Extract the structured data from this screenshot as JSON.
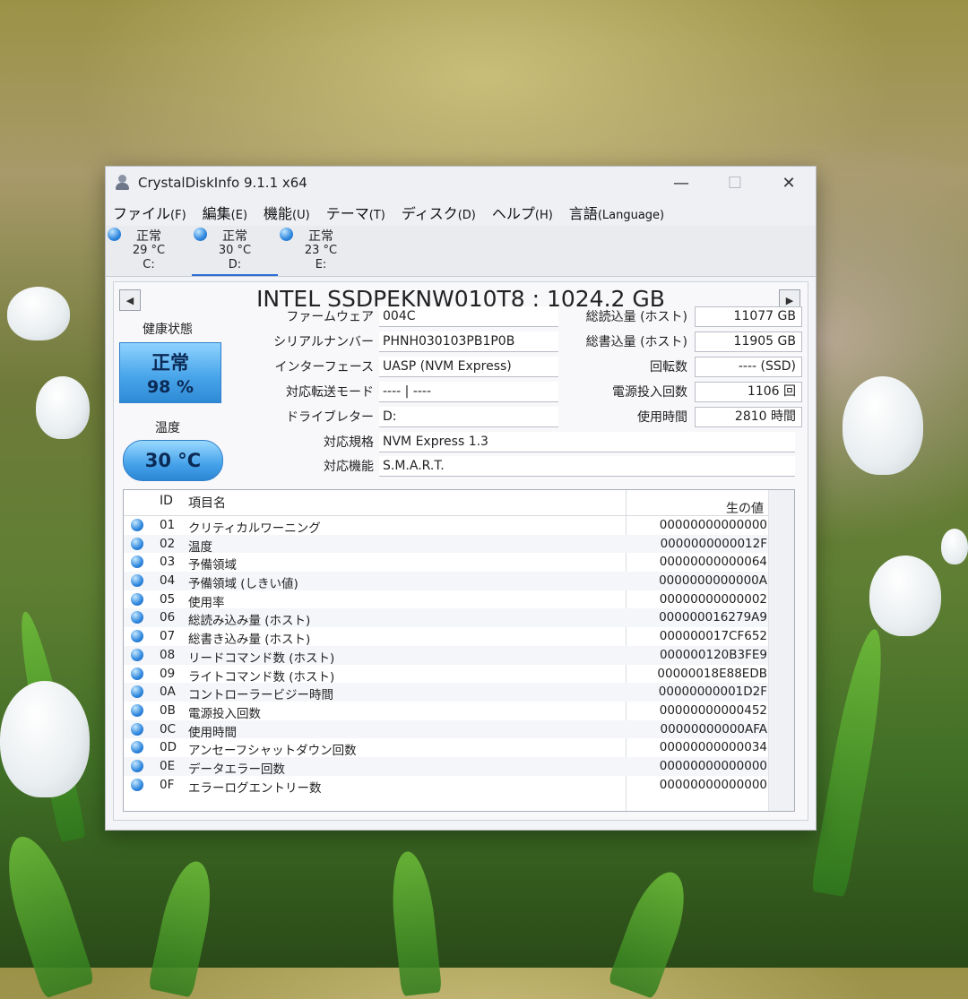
{
  "window": {
    "title": "CrystalDiskInfo 9.1.1 x64"
  },
  "menu": [
    {
      "label": "ファイル",
      "key": "(F)"
    },
    {
      "label": "編集",
      "key": "(E)"
    },
    {
      "label": "機能",
      "key": "(U)"
    },
    {
      "label": "テーマ",
      "key": "(T)"
    },
    {
      "label": "ディスク",
      "key": "(D)"
    },
    {
      "label": "ヘルプ",
      "key": "(H)"
    },
    {
      "label": "言語",
      "key": "(Language)"
    }
  ],
  "drives": [
    {
      "status": "正常",
      "temp": "29 °C",
      "letter": "C:"
    },
    {
      "status": "正常",
      "temp": "30 °C",
      "letter": "D:"
    },
    {
      "status": "正常",
      "temp": "23 °C",
      "letter": "E:"
    }
  ],
  "disk": {
    "title": "INTEL SSDPEKNW010T8 : 1024.2 GB",
    "health_label": "健康状態",
    "health_status": "正常",
    "health_percent": "98 %",
    "temp_label": "温度",
    "temp_value": "30 °C",
    "firmware_label": "ファームウェア",
    "firmware": "004C",
    "serial_label": "シリアルナンバー",
    "serial": "PHNH030103PB1P0B",
    "interface_label": "インターフェース",
    "interface": "UASP (NVM Express)",
    "transfer_label": "対応転送モード",
    "transfer": "---- | ----",
    "letter_label": "ドライブレター",
    "letter": "D:",
    "standard_label": "対応規格",
    "standard": "NVM Express 1.3",
    "features_label": "対応機能",
    "features": "S.M.A.R.T.",
    "host_reads_label": "総読込量 (ホスト)",
    "host_reads": "11077 GB",
    "host_writes_label": "総書込量 (ホスト)",
    "host_writes": "11905 GB",
    "rotation_label": "回転数",
    "rotation": "---- (SSD)",
    "power_count_label": "電源投入回数",
    "power_count": "1106 回",
    "power_hours_label": "使用時間",
    "power_hours": "2810 時間"
  },
  "smart": {
    "col_id": "ID",
    "col_name": "項目名",
    "col_raw": "生の値",
    "rows": [
      {
        "id": "01",
        "name": "クリティカルワーニング",
        "raw": "00000000000000"
      },
      {
        "id": "02",
        "name": "温度",
        "raw": "0000000000012F"
      },
      {
        "id": "03",
        "name": "予備領域",
        "raw": "00000000000064"
      },
      {
        "id": "04",
        "name": "予備領域 (しきい値)",
        "raw": "0000000000000A"
      },
      {
        "id": "05",
        "name": "使用率",
        "raw": "00000000000002"
      },
      {
        "id": "06",
        "name": "総読み込み量 (ホスト)",
        "raw": "000000016279A9"
      },
      {
        "id": "07",
        "name": "総書き込み量 (ホスト)",
        "raw": "000000017CF652"
      },
      {
        "id": "08",
        "name": "リードコマンド数 (ホスト)",
        "raw": "000000120B3FE9"
      },
      {
        "id": "09",
        "name": "ライトコマンド数 (ホスト)",
        "raw": "00000018E88EDB"
      },
      {
        "id": "0A",
        "name": "コントローラービジー時間",
        "raw": "00000000001D2F"
      },
      {
        "id": "0B",
        "name": "電源投入回数",
        "raw": "00000000000452"
      },
      {
        "id": "0C",
        "name": "使用時間",
        "raw": "00000000000AFA"
      },
      {
        "id": "0D",
        "name": "アンセーフシャットダウン回数",
        "raw": "00000000000034"
      },
      {
        "id": "0E",
        "name": "データエラー回数",
        "raw": "00000000000000"
      },
      {
        "id": "0F",
        "name": "エラーログエントリー数",
        "raw": "00000000000000"
      }
    ]
  }
}
